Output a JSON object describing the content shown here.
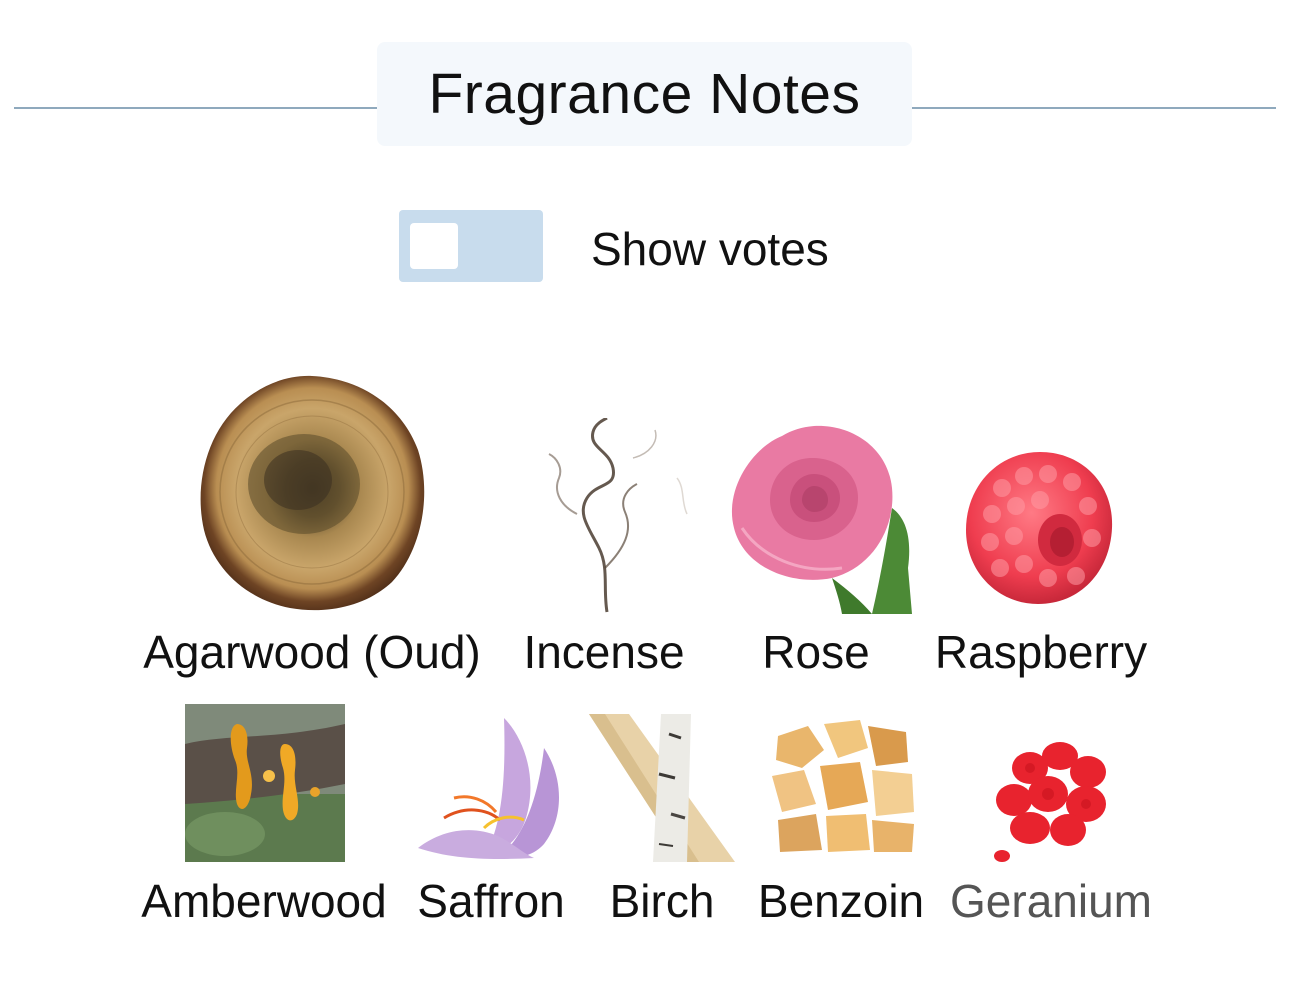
{
  "header": {
    "title": "Fragrance Notes"
  },
  "toggle": {
    "label": "Show votes",
    "state": "off",
    "track_color": "#c8dced"
  },
  "notes_rows": [
    [
      {
        "label": "Agarwood (Oud)",
        "icon": "agarwood-icon"
      },
      {
        "label": "Incense",
        "icon": "incense-smoke-icon"
      },
      {
        "label": "Rose",
        "icon": "rose-icon"
      },
      {
        "label": "Raspberry",
        "icon": "raspberry-icon"
      }
    ],
    [
      {
        "label": "Amberwood",
        "icon": "amberwood-resin-icon"
      },
      {
        "label": "Saffron",
        "icon": "saffron-flower-icon"
      },
      {
        "label": "Birch",
        "icon": "birch-bark-icon"
      },
      {
        "label": "Benzoin",
        "icon": "benzoin-resin-icon"
      },
      {
        "label": "Geranium",
        "icon": "geranium-icon"
      }
    ]
  ],
  "colors": {
    "divider": "#8fa9bd",
    "title_bg": "#f4f8fc"
  }
}
